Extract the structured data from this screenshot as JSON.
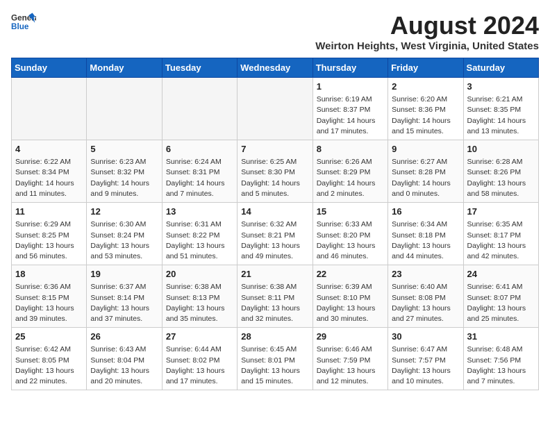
{
  "header": {
    "logo_general": "General",
    "logo_blue": "Blue",
    "month_title": "August 2024",
    "location": "Weirton Heights, West Virginia, United States"
  },
  "weekdays": [
    "Sunday",
    "Monday",
    "Tuesday",
    "Wednesday",
    "Thursday",
    "Friday",
    "Saturday"
  ],
  "weeks": [
    [
      {
        "day": "",
        "empty": true
      },
      {
        "day": "",
        "empty": true
      },
      {
        "day": "",
        "empty": true
      },
      {
        "day": "",
        "empty": true
      },
      {
        "day": "1",
        "sunrise": "6:19 AM",
        "sunset": "8:37 PM",
        "daylight": "14 hours and 17 minutes."
      },
      {
        "day": "2",
        "sunrise": "6:20 AM",
        "sunset": "8:36 PM",
        "daylight": "14 hours and 15 minutes."
      },
      {
        "day": "3",
        "sunrise": "6:21 AM",
        "sunset": "8:35 PM",
        "daylight": "14 hours and 13 minutes."
      }
    ],
    [
      {
        "day": "4",
        "sunrise": "6:22 AM",
        "sunset": "8:34 PM",
        "daylight": "14 hours and 11 minutes."
      },
      {
        "day": "5",
        "sunrise": "6:23 AM",
        "sunset": "8:32 PM",
        "daylight": "14 hours and 9 minutes."
      },
      {
        "day": "6",
        "sunrise": "6:24 AM",
        "sunset": "8:31 PM",
        "daylight": "14 hours and 7 minutes."
      },
      {
        "day": "7",
        "sunrise": "6:25 AM",
        "sunset": "8:30 PM",
        "daylight": "14 hours and 5 minutes."
      },
      {
        "day": "8",
        "sunrise": "6:26 AM",
        "sunset": "8:29 PM",
        "daylight": "14 hours and 2 minutes."
      },
      {
        "day": "9",
        "sunrise": "6:27 AM",
        "sunset": "8:28 PM",
        "daylight": "14 hours and 0 minutes."
      },
      {
        "day": "10",
        "sunrise": "6:28 AM",
        "sunset": "8:26 PM",
        "daylight": "13 hours and 58 minutes."
      }
    ],
    [
      {
        "day": "11",
        "sunrise": "6:29 AM",
        "sunset": "8:25 PM",
        "daylight": "13 hours and 56 minutes."
      },
      {
        "day": "12",
        "sunrise": "6:30 AM",
        "sunset": "8:24 PM",
        "daylight": "13 hours and 53 minutes."
      },
      {
        "day": "13",
        "sunrise": "6:31 AM",
        "sunset": "8:22 PM",
        "daylight": "13 hours and 51 minutes."
      },
      {
        "day": "14",
        "sunrise": "6:32 AM",
        "sunset": "8:21 PM",
        "daylight": "13 hours and 49 minutes."
      },
      {
        "day": "15",
        "sunrise": "6:33 AM",
        "sunset": "8:20 PM",
        "daylight": "13 hours and 46 minutes."
      },
      {
        "day": "16",
        "sunrise": "6:34 AM",
        "sunset": "8:18 PM",
        "daylight": "13 hours and 44 minutes."
      },
      {
        "day": "17",
        "sunrise": "6:35 AM",
        "sunset": "8:17 PM",
        "daylight": "13 hours and 42 minutes."
      }
    ],
    [
      {
        "day": "18",
        "sunrise": "6:36 AM",
        "sunset": "8:15 PM",
        "daylight": "13 hours and 39 minutes."
      },
      {
        "day": "19",
        "sunrise": "6:37 AM",
        "sunset": "8:14 PM",
        "daylight": "13 hours and 37 minutes."
      },
      {
        "day": "20",
        "sunrise": "6:38 AM",
        "sunset": "8:13 PM",
        "daylight": "13 hours and 35 minutes."
      },
      {
        "day": "21",
        "sunrise": "6:38 AM",
        "sunset": "8:11 PM",
        "daylight": "13 hours and 32 minutes."
      },
      {
        "day": "22",
        "sunrise": "6:39 AM",
        "sunset": "8:10 PM",
        "daylight": "13 hours and 30 minutes."
      },
      {
        "day": "23",
        "sunrise": "6:40 AM",
        "sunset": "8:08 PM",
        "daylight": "13 hours and 27 minutes."
      },
      {
        "day": "24",
        "sunrise": "6:41 AM",
        "sunset": "8:07 PM",
        "daylight": "13 hours and 25 minutes."
      }
    ],
    [
      {
        "day": "25",
        "sunrise": "6:42 AM",
        "sunset": "8:05 PM",
        "daylight": "13 hours and 22 minutes."
      },
      {
        "day": "26",
        "sunrise": "6:43 AM",
        "sunset": "8:04 PM",
        "daylight": "13 hours and 20 minutes."
      },
      {
        "day": "27",
        "sunrise": "6:44 AM",
        "sunset": "8:02 PM",
        "daylight": "13 hours and 17 minutes."
      },
      {
        "day": "28",
        "sunrise": "6:45 AM",
        "sunset": "8:01 PM",
        "daylight": "13 hours and 15 minutes."
      },
      {
        "day": "29",
        "sunrise": "6:46 AM",
        "sunset": "7:59 PM",
        "daylight": "13 hours and 12 minutes."
      },
      {
        "day": "30",
        "sunrise": "6:47 AM",
        "sunset": "7:57 PM",
        "daylight": "13 hours and 10 minutes."
      },
      {
        "day": "31",
        "sunrise": "6:48 AM",
        "sunset": "7:56 PM",
        "daylight": "13 hours and 7 minutes."
      }
    ]
  ]
}
